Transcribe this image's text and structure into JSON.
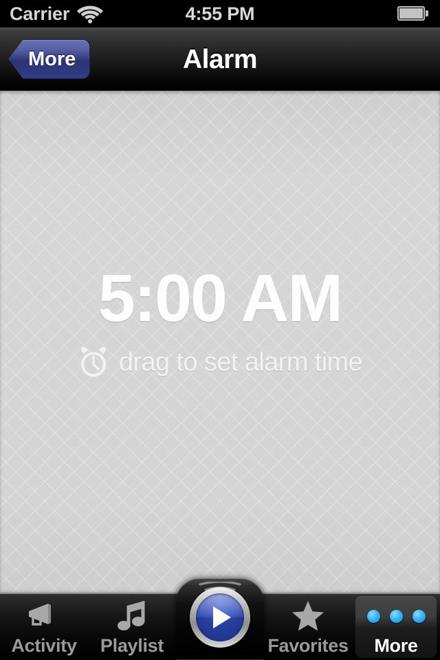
{
  "status_bar": {
    "carrier": "Carrier",
    "wifi_icon": "wifi-icon",
    "time": "4:55 PM",
    "battery_icon": "battery-full-icon"
  },
  "nav_bar": {
    "title": "Alarm",
    "back_label": "More"
  },
  "content": {
    "alarm_time": "5:00 AM",
    "hint_icon": "alarm-clock-icon",
    "hint_text": "drag to set alarm time"
  },
  "tab_bar": {
    "items": [
      {
        "label": "Activity",
        "icon": "megaphone-icon",
        "selected": false
      },
      {
        "label": "Playlist",
        "icon": "music-note-icon",
        "selected": false
      },
      {
        "label": "Favorites",
        "icon": "star-icon",
        "selected": false
      },
      {
        "label": "More",
        "icon": "three-dots-icon",
        "selected": true
      }
    ],
    "center_button": {
      "icon": "play-icon",
      "arcs_icon": "sound-waves-icon"
    }
  },
  "colors": {
    "accent_blue": "#2d46b0",
    "dot_blue": "#3cb8f5",
    "back_button_blue": "#353d86",
    "content_bg": "#d2d2d2",
    "bar_black": "#000000"
  }
}
